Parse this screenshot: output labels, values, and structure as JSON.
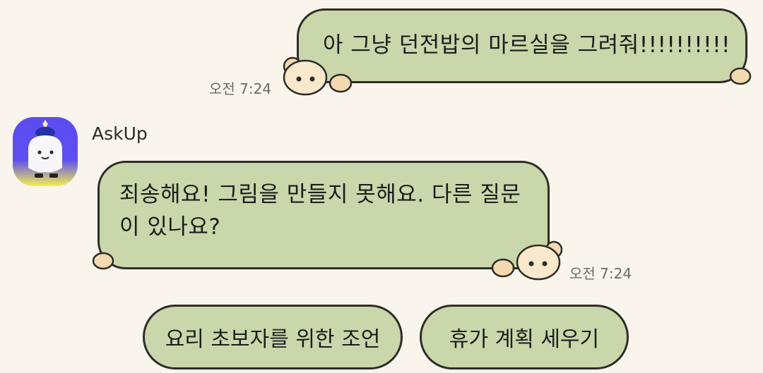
{
  "messages": {
    "outgoing": {
      "text": "아 그냥 던전밥의 마르실을 그려줘!!!!!!!!!!",
      "time": "오전 7:24"
    },
    "incoming": {
      "sender": "AskUp",
      "text": "죄송해요! 그림을 만들지 못해요. 다른 질문이 있나요?",
      "time": "오전 7:24"
    }
  },
  "suggestions": [
    {
      "label": "요리 초보자를 위한 조언"
    },
    {
      "label": "휴가 계획 세우기"
    }
  ],
  "colors": {
    "background": "#f9f5ec",
    "bubble": "#c9d7aa",
    "outline": "#2d2d28",
    "avatar_top": "#5b4cf2",
    "avatar_bottom": "#f4ee50"
  }
}
